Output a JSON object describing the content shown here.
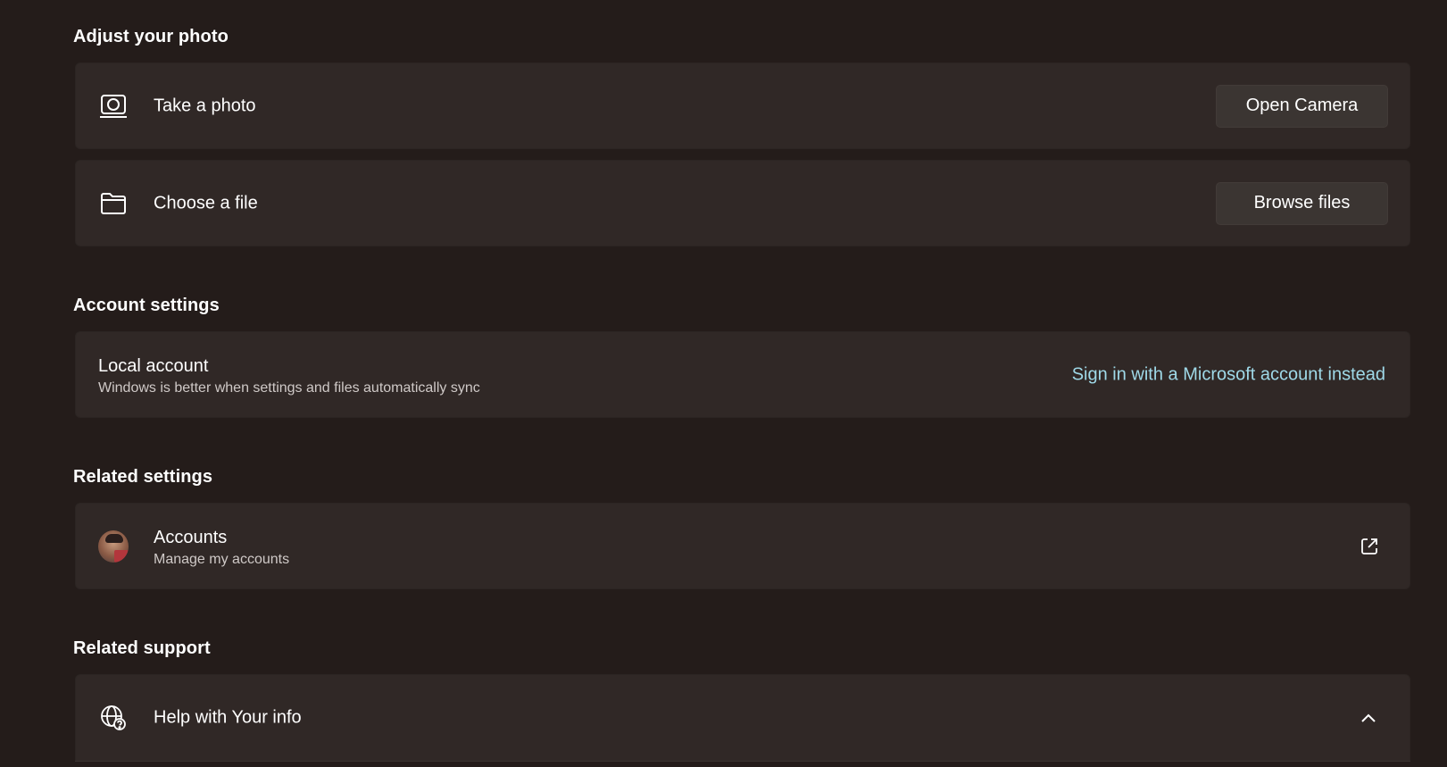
{
  "adjust_photo": {
    "title": "Adjust your photo",
    "take_photo": {
      "label": "Take a photo",
      "icon": "camera-icon",
      "button": "Open Camera"
    },
    "choose_file": {
      "label": "Choose a file",
      "icon": "folder-icon",
      "button": "Browse files"
    }
  },
  "account_settings": {
    "title": "Account settings",
    "local_account": {
      "label": "Local account",
      "description": "Windows is better when settings and files automatically sync",
      "link": "Sign in with a Microsoft account instead"
    }
  },
  "related_settings": {
    "title": "Related settings",
    "accounts": {
      "label": "Accounts",
      "description": "Manage my accounts",
      "icon": "avatar",
      "trailing_icon": "open-external-icon"
    }
  },
  "related_support": {
    "title": "Related support",
    "help": {
      "label": "Help with Your info",
      "icon": "globe-help-icon",
      "trailing_icon": "chevron-up-icon"
    }
  },
  "colors": {
    "background": "#241c1a",
    "card": "#302826",
    "button": "#3b3532",
    "link": "#9fd9e8"
  }
}
